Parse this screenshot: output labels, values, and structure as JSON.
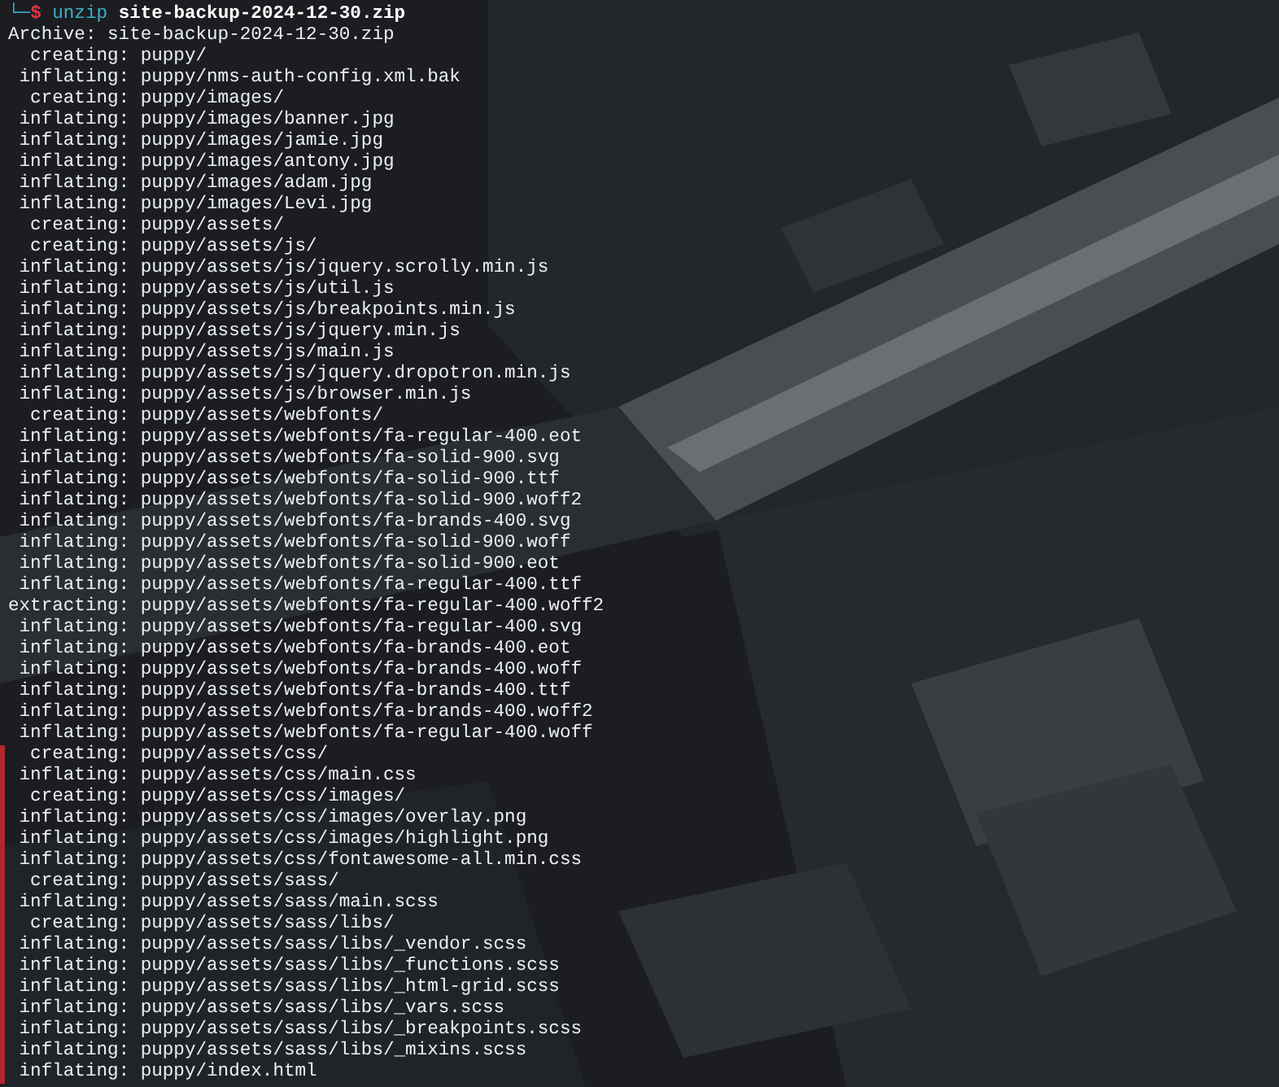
{
  "prompt": {
    "corner": "└─",
    "symbol": "$",
    "command": "unzip",
    "argument": "site-backup-2024-12-30.zip"
  },
  "archive": {
    "label": "Archive:",
    "file": "site-backup-2024-12-30.zip"
  },
  "lines": [
    {
      "action": "creating:",
      "path": "puppy/",
      "marked": false
    },
    {
      "action": "inflating:",
      "path": "puppy/nms-auth-config.xml.bak",
      "marked": false
    },
    {
      "action": "creating:",
      "path": "puppy/images/",
      "marked": false
    },
    {
      "action": "inflating:",
      "path": "puppy/images/banner.jpg",
      "marked": false
    },
    {
      "action": "inflating:",
      "path": "puppy/images/jamie.jpg",
      "marked": false
    },
    {
      "action": "inflating:",
      "path": "puppy/images/antony.jpg",
      "marked": false
    },
    {
      "action": "inflating:",
      "path": "puppy/images/adam.jpg",
      "marked": false
    },
    {
      "action": "inflating:",
      "path": "puppy/images/Levi.jpg",
      "marked": false
    },
    {
      "action": "creating:",
      "path": "puppy/assets/",
      "marked": false
    },
    {
      "action": "creating:",
      "path": "puppy/assets/js/",
      "marked": false
    },
    {
      "action": "inflating:",
      "path": "puppy/assets/js/jquery.scrolly.min.js",
      "marked": false
    },
    {
      "action": "inflating:",
      "path": "puppy/assets/js/util.js",
      "marked": false
    },
    {
      "action": "inflating:",
      "path": "puppy/assets/js/breakpoints.min.js",
      "marked": false
    },
    {
      "action": "inflating:",
      "path": "puppy/assets/js/jquery.min.js",
      "marked": false
    },
    {
      "action": "inflating:",
      "path": "puppy/assets/js/main.js",
      "marked": false
    },
    {
      "action": "inflating:",
      "path": "puppy/assets/js/jquery.dropotron.min.js",
      "marked": false
    },
    {
      "action": "inflating:",
      "path": "puppy/assets/js/browser.min.js",
      "marked": false
    },
    {
      "action": "creating:",
      "path": "puppy/assets/webfonts/",
      "marked": false
    },
    {
      "action": "inflating:",
      "path": "puppy/assets/webfonts/fa-regular-400.eot",
      "marked": false
    },
    {
      "action": "inflating:",
      "path": "puppy/assets/webfonts/fa-solid-900.svg",
      "marked": false
    },
    {
      "action": "inflating:",
      "path": "puppy/assets/webfonts/fa-solid-900.ttf",
      "marked": false
    },
    {
      "action": "inflating:",
      "path": "puppy/assets/webfonts/fa-solid-900.woff2",
      "marked": false
    },
    {
      "action": "inflating:",
      "path": "puppy/assets/webfonts/fa-brands-400.svg",
      "marked": false
    },
    {
      "action": "inflating:",
      "path": "puppy/assets/webfonts/fa-solid-900.woff",
      "marked": false
    },
    {
      "action": "inflating:",
      "path": "puppy/assets/webfonts/fa-solid-900.eot",
      "marked": false
    },
    {
      "action": "inflating:",
      "path": "puppy/assets/webfonts/fa-regular-400.ttf",
      "marked": false
    },
    {
      "action": "extracting:",
      "path": "puppy/assets/webfonts/fa-regular-400.woff2",
      "marked": false
    },
    {
      "action": "inflating:",
      "path": "puppy/assets/webfonts/fa-regular-400.svg",
      "marked": false
    },
    {
      "action": "inflating:",
      "path": "puppy/assets/webfonts/fa-brands-400.eot",
      "marked": false
    },
    {
      "action": "inflating:",
      "path": "puppy/assets/webfonts/fa-brands-400.woff",
      "marked": false
    },
    {
      "action": "inflating:",
      "path": "puppy/assets/webfonts/fa-brands-400.ttf",
      "marked": false
    },
    {
      "action": "inflating:",
      "path": "puppy/assets/webfonts/fa-brands-400.woff2",
      "marked": false
    },
    {
      "action": "inflating:",
      "path": "puppy/assets/webfonts/fa-regular-400.woff",
      "marked": false
    },
    {
      "action": "creating:",
      "path": "puppy/assets/css/",
      "marked": true
    },
    {
      "action": "inflating:",
      "path": "puppy/assets/css/main.css",
      "marked": true
    },
    {
      "action": "creating:",
      "path": "puppy/assets/css/images/",
      "marked": true
    },
    {
      "action": "inflating:",
      "path": "puppy/assets/css/images/overlay.png",
      "marked": true
    },
    {
      "action": "inflating:",
      "path": "puppy/assets/css/images/highlight.png",
      "marked": true
    },
    {
      "action": "inflating:",
      "path": "puppy/assets/css/fontawesome-all.min.css",
      "marked": true
    },
    {
      "action": "creating:",
      "path": "puppy/assets/sass/",
      "marked": true
    },
    {
      "action": "inflating:",
      "path": "puppy/assets/sass/main.scss",
      "marked": true
    },
    {
      "action": "creating:",
      "path": "puppy/assets/sass/libs/",
      "marked": true
    },
    {
      "action": "inflating:",
      "path": "puppy/assets/sass/libs/_vendor.scss",
      "marked": true
    },
    {
      "action": "inflating:",
      "path": "puppy/assets/sass/libs/_functions.scss",
      "marked": true
    },
    {
      "action": "inflating:",
      "path": "puppy/assets/sass/libs/_html-grid.scss",
      "marked": true
    },
    {
      "action": "inflating:",
      "path": "puppy/assets/sass/libs/_vars.scss",
      "marked": true
    },
    {
      "action": "inflating:",
      "path": "puppy/assets/sass/libs/_breakpoints.scss",
      "marked": true
    },
    {
      "action": "inflating:",
      "path": "puppy/assets/sass/libs/_mixins.scss",
      "marked": true
    },
    {
      "action": "inflating:",
      "path": "puppy/index.html",
      "marked": true
    }
  ]
}
